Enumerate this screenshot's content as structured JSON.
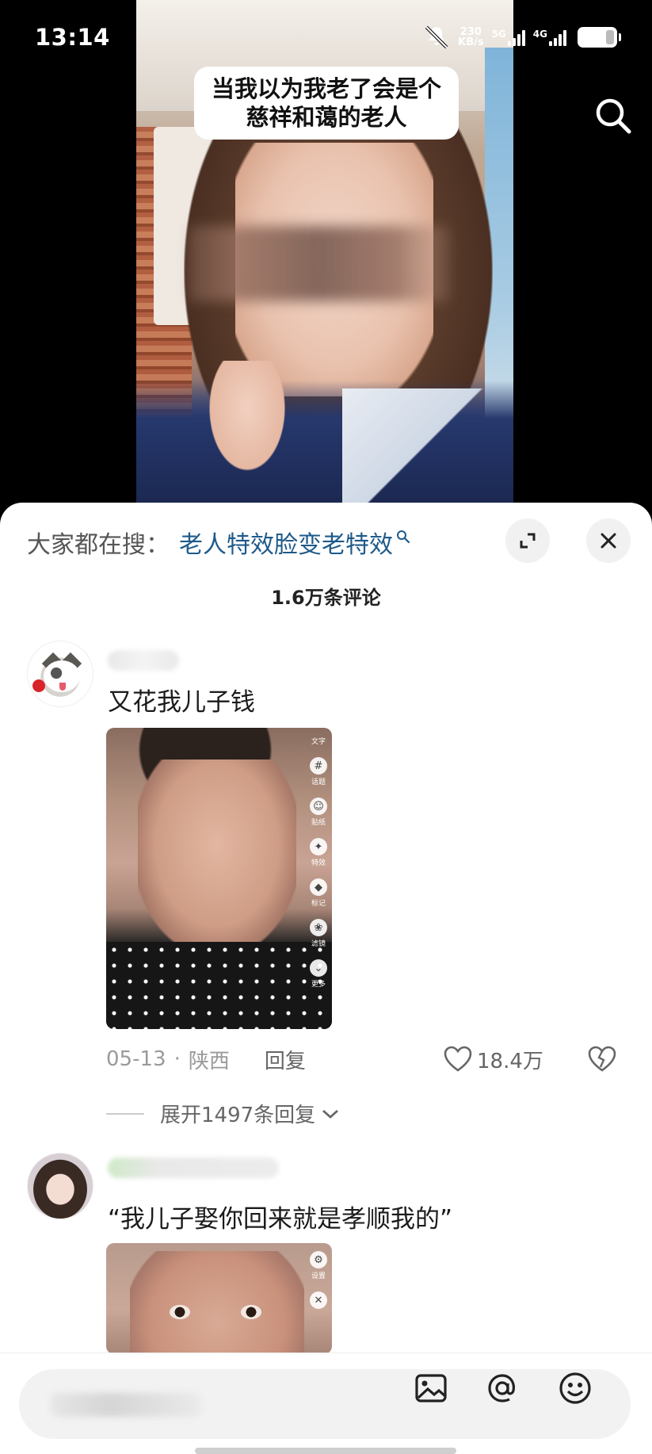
{
  "status_bar": {
    "time": "13:14",
    "net_speed_value": "230",
    "net_speed_unit": "KB/s",
    "signal1_label": "5G",
    "signal2_label": "4G"
  },
  "video": {
    "caption": "当我以为我老了会是个慈祥和蔼的老人"
  },
  "comments_panel": {
    "search_prefix": "大家都在搜：",
    "search_term": "老人特效脸变老特效",
    "comment_count": "1.6万条评论",
    "comments": [
      {
        "text": "又花我儿子钱",
        "date": "05-13",
        "separator": "·",
        "location": "陕西",
        "reply_label": "回复",
        "likes": "18.4万",
        "expand_label": "展开1497条回复",
        "thumb_tools": [
          "文字",
          "话题",
          "贴纸",
          "特效",
          "标记",
          "滤镜",
          "更多"
        ]
      },
      {
        "text": "“我儿子娶你回来就是孝顺我的”",
        "thumb_tools": [
          "设置"
        ]
      }
    ]
  },
  "colors": {
    "accent_link": "#1e5a8a",
    "panel_bg": "#ffffff",
    "input_bg": "#f2f2f2"
  },
  "icons": {
    "top_right": "search-icon",
    "panel_expand": "expand-icon",
    "panel_close": "close-icon",
    "like": "heart-icon",
    "dislike": "broken-heart-icon",
    "image": "image-icon",
    "mention": "at-icon",
    "emoji": "emoji-icon"
  }
}
